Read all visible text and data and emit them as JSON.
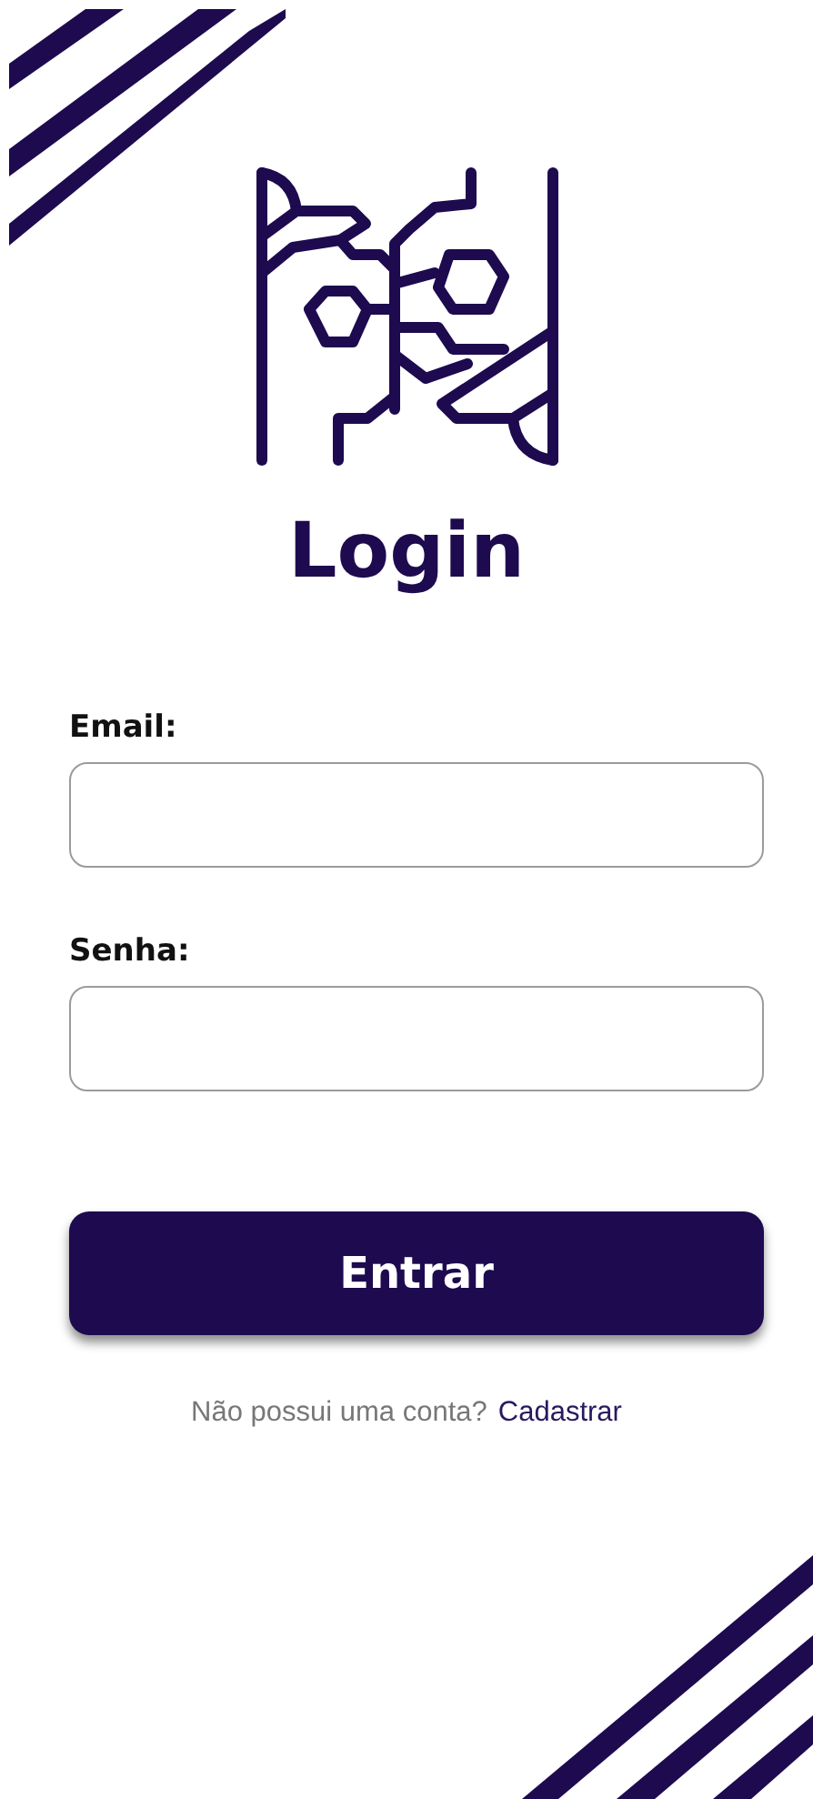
{
  "title": "Login",
  "fields": [
    {
      "label": "Email:"
    },
    {
      "label": "Senha:"
    }
  ],
  "submit": {
    "label": "Entrar"
  },
  "signup": {
    "prompt": "Não possui uma conta?",
    "link": "Cadastrar"
  }
}
